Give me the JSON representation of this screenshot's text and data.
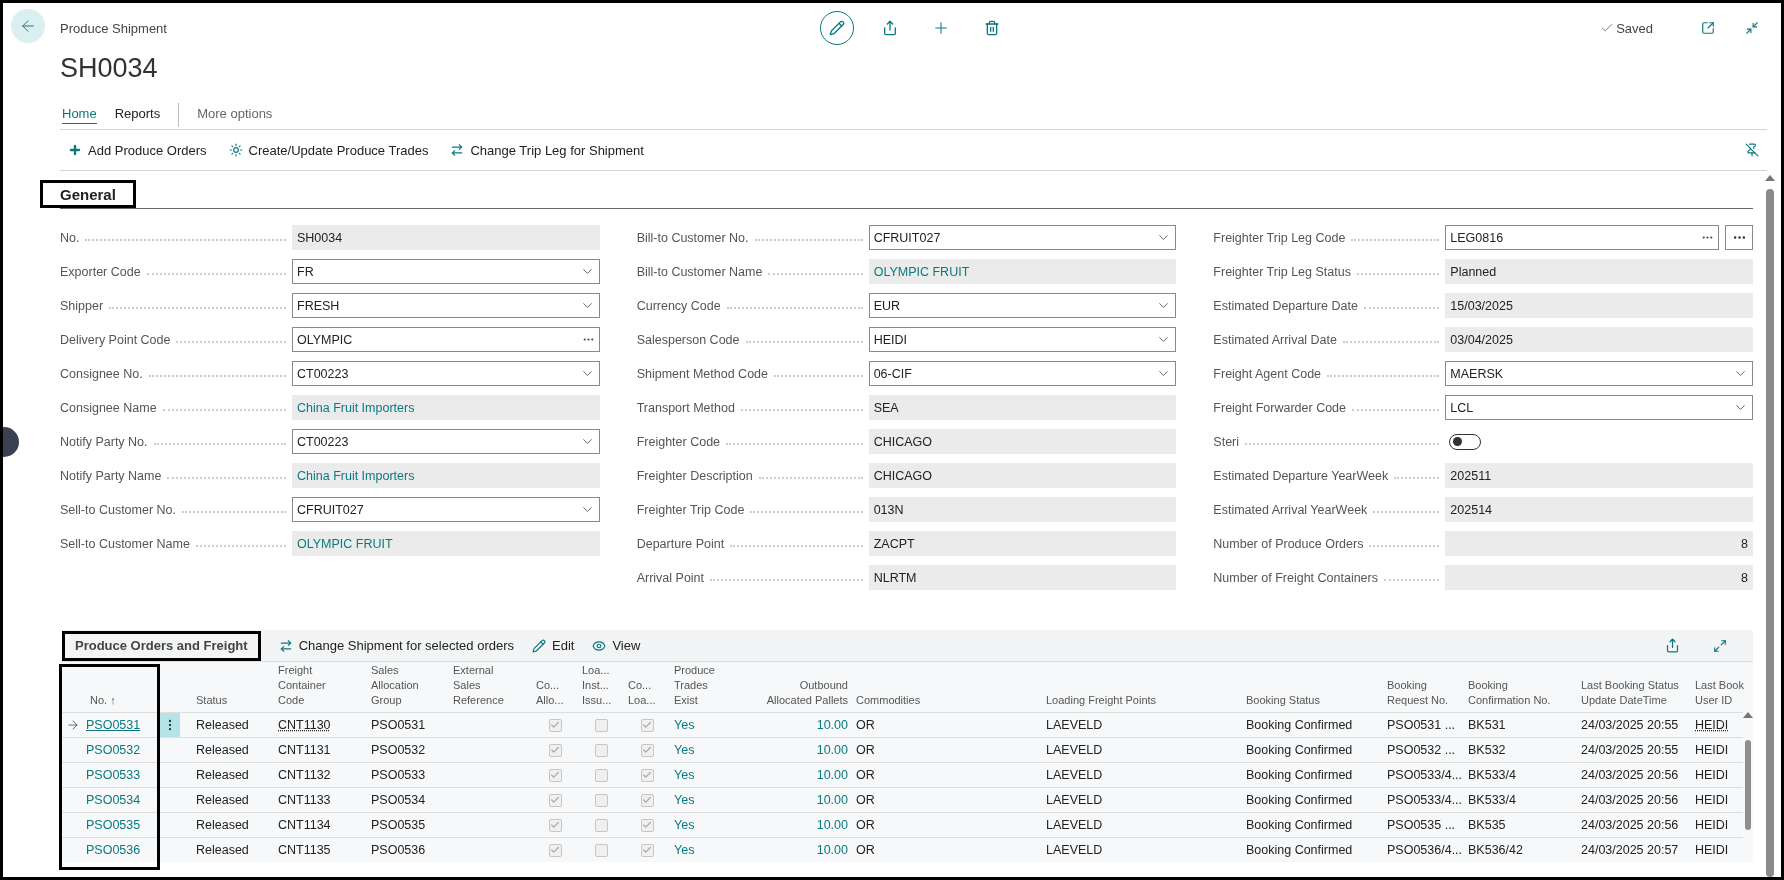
{
  "header": {
    "breadcrumb": "Produce Shipment",
    "title": "SH0034",
    "status": "Saved"
  },
  "tabs": [
    {
      "label": "Home",
      "selected": true
    },
    {
      "label": "Reports",
      "selected": false
    },
    {
      "label": "More options",
      "selected": false
    }
  ],
  "actions": [
    {
      "kind": "add",
      "label": "Add Produce Orders"
    },
    {
      "kind": "generate",
      "label": "Create/Update Produce Trades"
    },
    {
      "kind": "switch",
      "label": "Change Trip Leg for Shipment"
    }
  ],
  "general": {
    "title": "General",
    "columns": [
      [
        {
          "label": "No.",
          "kind": "readonly",
          "value": "SH0034"
        },
        {
          "label": "Exporter Code",
          "kind": "dropdown",
          "value": "FR"
        },
        {
          "label": "Shipper",
          "kind": "dropdown",
          "value": "FRESH"
        },
        {
          "label": "Delivery Point Code",
          "kind": "lookup",
          "value": "OLYMPIC"
        },
        {
          "label": "Consignee No.",
          "kind": "dropdown",
          "value": "CT00223"
        },
        {
          "label": "Consignee Name",
          "kind": "readonly_link",
          "value": "China Fruit Importers"
        },
        {
          "label": "Notify Party No.",
          "kind": "dropdown",
          "value": "CT00223"
        },
        {
          "label": "Notify Party Name",
          "kind": "readonly_link",
          "value": "China Fruit Importers"
        },
        {
          "label": "Sell-to Customer No.",
          "kind": "dropdown",
          "value": "CFRUIT027"
        },
        {
          "label": "Sell-to Customer Name",
          "kind": "readonly_link",
          "value": "OLYMPIC FRUIT"
        }
      ],
      [
        {
          "label": "Bill-to Customer No.",
          "kind": "dropdown",
          "value": "CFRUIT027"
        },
        {
          "label": "Bill-to Customer Name",
          "kind": "readonly_link",
          "value": "OLYMPIC FRUIT"
        },
        {
          "label": "Currency Code",
          "kind": "dropdown",
          "value": "EUR"
        },
        {
          "label": "Salesperson Code",
          "kind": "dropdown",
          "value": "HEIDI"
        },
        {
          "label": "Shipment Method Code",
          "kind": "dropdown",
          "value": "06-CIF"
        },
        {
          "label": "Transport Method",
          "kind": "readonly",
          "value": "SEA"
        },
        {
          "label": "Freighter Code",
          "kind": "readonly",
          "value": "CHICAGO"
        },
        {
          "label": "Freighter Description",
          "kind": "readonly",
          "value": "CHICAGO"
        },
        {
          "label": "Freighter Trip Code",
          "kind": "readonly",
          "value": "013N"
        },
        {
          "label": "Departure Point",
          "kind": "readonly",
          "value": "ZACPT"
        },
        {
          "label": "Arrival Point",
          "kind": "readonly",
          "value": "NLRTM"
        }
      ],
      [
        {
          "label": "Freighter Trip Leg Code",
          "kind": "lookup_button",
          "value": "LEG0816"
        },
        {
          "label": "Freighter Trip Leg Status",
          "kind": "readonly",
          "value": "Planned"
        },
        {
          "label": "Estimated Departure Date",
          "kind": "readonly",
          "value": "15/03/2025"
        },
        {
          "label": "Estimated Arrival Date",
          "kind": "readonly",
          "value": "03/04/2025"
        },
        {
          "label": "Freight Agent Code",
          "kind": "dropdown",
          "value": "MAERSK"
        },
        {
          "label": "Freight Forwarder Code",
          "kind": "dropdown",
          "value": "LCL"
        },
        {
          "label": "Steri",
          "kind": "toggle",
          "on": false
        },
        {
          "label": "Estimated Departure YearWeek",
          "kind": "readonly",
          "value": "202511"
        },
        {
          "label": "Estimated Arrival YearWeek",
          "kind": "readonly",
          "value": "202514"
        },
        {
          "label": "Number of Produce Orders",
          "kind": "number",
          "value": "8"
        },
        {
          "label": "Number of Freight Containers",
          "kind": "number",
          "value": "8"
        }
      ]
    ]
  },
  "lines": {
    "title": "Produce Orders and Freight",
    "actions": [
      {
        "kind": "switch",
        "label": "Change Shipment for selected orders"
      },
      {
        "kind": "edit",
        "label": "Edit"
      },
      {
        "kind": "view",
        "label": "View"
      }
    ],
    "columns": [
      {
        "label": "No. ↑",
        "kind": "link"
      },
      {
        "label": "Status",
        "kind": "text"
      },
      {
        "label": "Freight\nContainer\nCode",
        "kind": "text"
      },
      {
        "label": "Sales\nAllocation\nGroup",
        "kind": "text"
      },
      {
        "label": "External\nSales\nReference",
        "kind": "text"
      },
      {
        "label": "Co...\nAllo...",
        "kind": "check"
      },
      {
        "label": "Loa...\nInst...\nIssu...",
        "kind": "check"
      },
      {
        "label": "Co...\nLoa...",
        "kind": "check"
      },
      {
        "label": "Produce\nTrades\nExist",
        "kind": "link"
      },
      {
        "label": "Outbound\nAllocated Pallets",
        "kind": "number"
      },
      {
        "label": "Commodities",
        "kind": "text"
      },
      {
        "label": "Loading Freight Points",
        "kind": "text"
      },
      {
        "label": "Booking Status",
        "kind": "text"
      },
      {
        "label": "Booking\nRequest No.",
        "kind": "text"
      },
      {
        "label": "Booking\nConfirmation No.",
        "kind": "text"
      },
      {
        "label": "Last Booking Status\nUpdate DateTime",
        "kind": "text"
      },
      {
        "label": "Last Book\nUser ID",
        "kind": "text"
      }
    ],
    "rows": [
      {
        "selected": true,
        "cells": [
          "PSO0531",
          "Released",
          "CNT1130",
          "PSO0531",
          null,
          true,
          false,
          true,
          "Yes",
          "10.00",
          "OR",
          "LAEVELD",
          "Booking Confirmed",
          "PSO0531 ...",
          "BK531",
          "24/03/2025 20:55",
          "HEIDI"
        ]
      },
      {
        "selected": false,
        "cells": [
          "PSO0532",
          "Released",
          "CNT1131",
          "PSO0532",
          null,
          true,
          false,
          true,
          "Yes",
          "10.00",
          "OR",
          "LAEVELD",
          "Booking Confirmed",
          "PSO0532 ...",
          "BK532",
          "24/03/2025 20:55",
          "HEIDI"
        ]
      },
      {
        "selected": false,
        "cells": [
          "PSO0533",
          "Released",
          "CNT1132",
          "PSO0533",
          null,
          true,
          false,
          true,
          "Yes",
          "10.00",
          "OR",
          "LAEVELD",
          "Booking Confirmed",
          "PSO0533/4...",
          "BK533/4",
          "24/03/2025 20:56",
          "HEIDI"
        ]
      },
      {
        "selected": false,
        "cells": [
          "PSO0534",
          "Released",
          "CNT1133",
          "PSO0534",
          null,
          true,
          false,
          true,
          "Yes",
          "10.00",
          "OR",
          "LAEVELD",
          "Booking Confirmed",
          "PSO0533/4...",
          "BK533/4",
          "24/03/2025 20:56",
          "HEIDI"
        ]
      },
      {
        "selected": false,
        "cells": [
          "PSO0535",
          "Released",
          "CNT1134",
          "PSO0535",
          null,
          true,
          false,
          true,
          "Yes",
          "10.00",
          "OR",
          "LAEVELD",
          "Booking Confirmed",
          "PSO0535 ...",
          "BK535",
          "24/03/2025 20:56",
          "HEIDI"
        ]
      },
      {
        "selected": false,
        "cells": [
          "PSO0536",
          "Released",
          "CNT1135",
          "PSO0536",
          null,
          true,
          false,
          true,
          "Yes",
          "10.00",
          "OR",
          "LAEVELD",
          "Booking Confirmed",
          "PSO0536/4...",
          "BK536/42",
          "24/03/2025 20:57",
          "HEIDI"
        ]
      }
    ]
  }
}
